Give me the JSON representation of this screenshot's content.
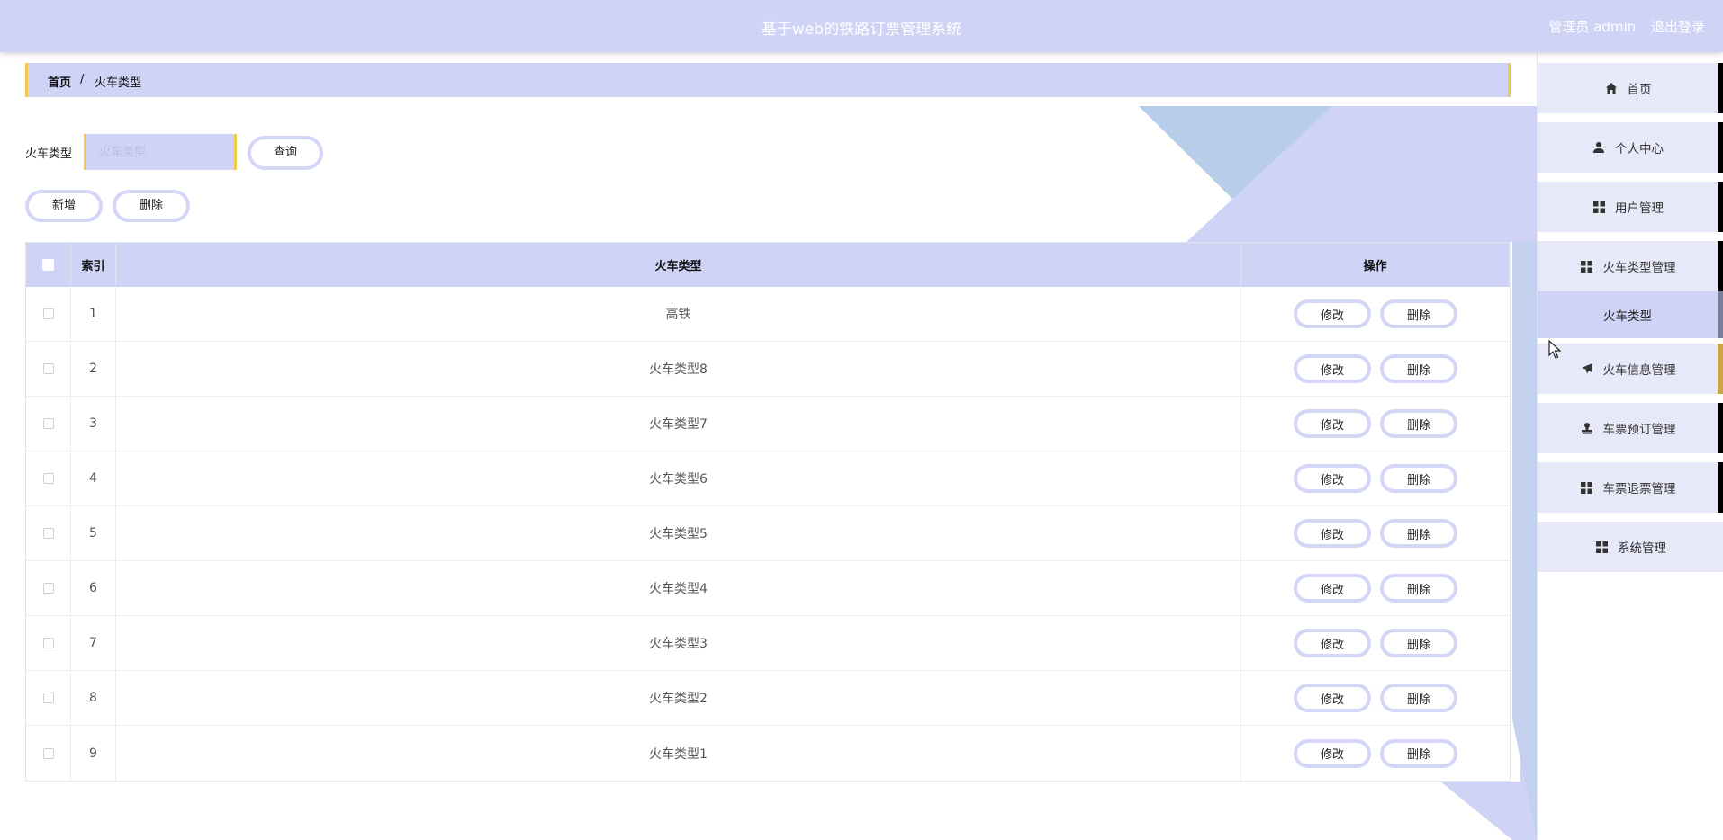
{
  "header": {
    "title": "基于web的铁路订票管理系统",
    "role": "管理员 admin",
    "logout": "退出登录"
  },
  "breadcrumb": {
    "home": "首页",
    "separator": "/",
    "current": "火车类型"
  },
  "search": {
    "label": "火车类型",
    "placeholder": "火车类型",
    "value": "",
    "query_label": "查询"
  },
  "toolbar": {
    "add_label": "新增",
    "delete_label": "删除"
  },
  "table": {
    "columns": [
      "",
      "索引",
      "火车类型",
      "操作"
    ],
    "edit_label": "修改",
    "delete_label": "删除",
    "rows": [
      {
        "index": "1",
        "type": "高铁"
      },
      {
        "index": "2",
        "type": "火车类型8"
      },
      {
        "index": "3",
        "type": "火车类型7"
      },
      {
        "index": "4",
        "type": "火车类型6"
      },
      {
        "index": "5",
        "type": "火车类型5"
      },
      {
        "index": "6",
        "type": "火车类型4"
      },
      {
        "index": "7",
        "type": "火车类型3"
      },
      {
        "index": "8",
        "type": "火车类型2"
      },
      {
        "index": "9",
        "type": "火车类型1"
      }
    ]
  },
  "sidebar": {
    "items": [
      {
        "label": "首页",
        "icon": "home-icon"
      },
      {
        "label": "个人中心",
        "icon": "user-icon"
      },
      {
        "label": "用户管理",
        "icon": "grid-icon"
      },
      {
        "label": "火车类型管理",
        "icon": "grid-icon"
      },
      {
        "label": "火车信息管理",
        "icon": "send-icon"
      },
      {
        "label": "车票预订管理",
        "icon": "stamp-icon"
      },
      {
        "label": "车票退票管理",
        "icon": "grid-icon"
      },
      {
        "label": "系统管理",
        "icon": "grid-icon"
      }
    ],
    "sub_item": {
      "label": "火车类型"
    }
  },
  "colors": {
    "accent": "#cfd3f5",
    "border_accent": "#f2c94c",
    "button_border": "#d4d6f6"
  }
}
